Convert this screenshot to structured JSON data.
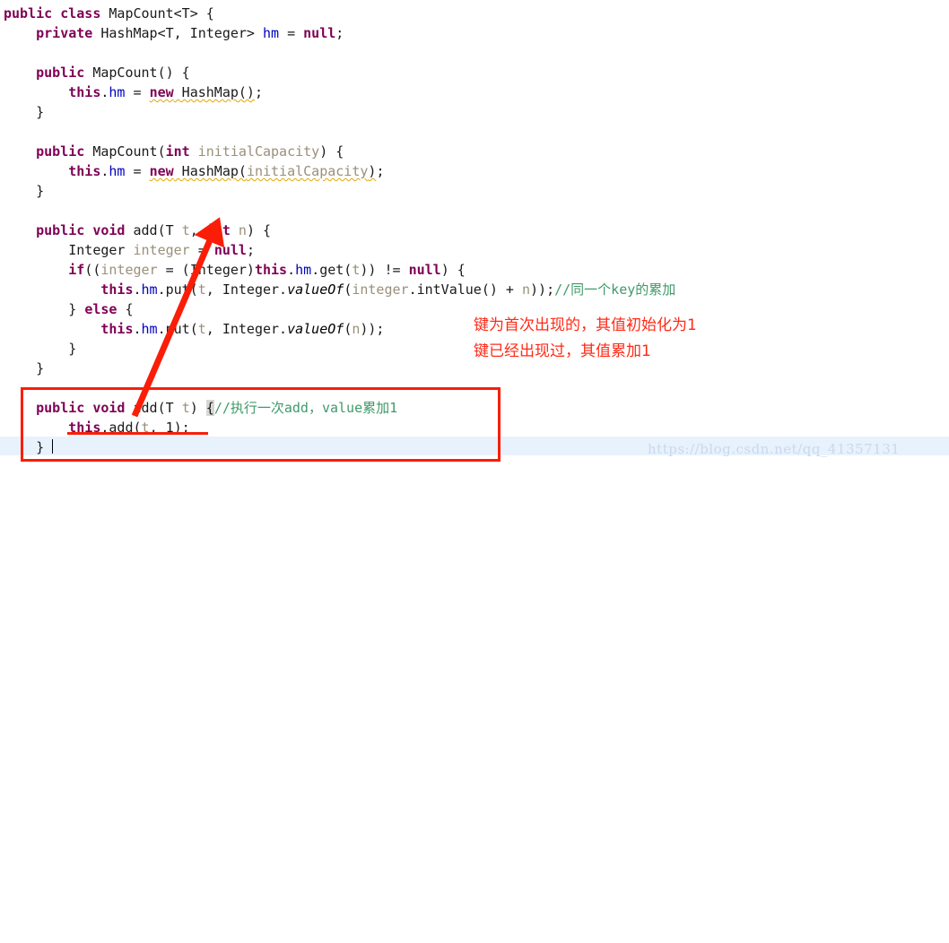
{
  "watermark": "https://blog.csdn.net/qq_41357131",
  "colors": {
    "keyword": "#7f0055",
    "field": "#0000c0",
    "parameter": "#9a8f7a",
    "comment": "#3f9a6a",
    "annotation_red": "#ff2a17",
    "box_red": "#fa1e09",
    "current_line": "#e8f2fc",
    "background": "#ffffff",
    "watermark": "#c9d8ef"
  },
  "code": {
    "language": "java",
    "lines": [
      {
        "n": 1,
        "text": "public class MapCount<T> {"
      },
      {
        "n": 2,
        "text": "    private HashMap<T, Integer> hm = null;"
      },
      {
        "n": 3,
        "text": ""
      },
      {
        "n": 4,
        "text": "    public MapCount() {"
      },
      {
        "n": 5,
        "text": "        this.hm = new HashMap();"
      },
      {
        "n": 6,
        "text": "    }"
      },
      {
        "n": 7,
        "text": ""
      },
      {
        "n": 8,
        "text": "    public MapCount(int initialCapacity) {"
      },
      {
        "n": 9,
        "text": "        this.hm = new HashMap(initialCapacity);"
      },
      {
        "n": 10,
        "text": "    }"
      },
      {
        "n": 11,
        "text": ""
      },
      {
        "n": 12,
        "text": "    public void add(T t, int n) {"
      },
      {
        "n": 13,
        "text": "        Integer integer = null;"
      },
      {
        "n": 14,
        "text": "        if((integer = (Integer)this.hm.get(t)) != null) {"
      },
      {
        "n": 15,
        "text": "            this.hm.put(t, Integer.valueOf(integer.intValue() + n));//同一个key的累加"
      },
      {
        "n": 16,
        "text": "        } else {"
      },
      {
        "n": 17,
        "text": "            this.hm.put(t, Integer.valueOf(n));"
      },
      {
        "n": 18,
        "text": "        }"
      },
      {
        "n": 19,
        "text": "    }"
      },
      {
        "n": 20,
        "text": ""
      },
      {
        "n": 21,
        "text": "    public void add(T t) {//执行一次add，value累加1"
      },
      {
        "n": 22,
        "text": "        this.add(t, 1);"
      },
      {
        "n": 23,
        "text": "    }"
      }
    ]
  },
  "annotations": {
    "red_notes": [
      "键为首次出现的，其值初始化为1",
      "键已经出现过，其值累加1"
    ],
    "inline_comments": [
      "//同一个key的累加",
      "//执行一次add，value累加1"
    ],
    "arrow": {
      "name": "red-arrow",
      "from": "public void add(T t)",
      "to": "add(T t, int n)"
    },
    "highlight_box": {
      "name": "red-rectangle",
      "encloses": "public void add(T t) { this.add(t, 1); }"
    },
    "underline": {
      "name": "red-underline",
      "under": "this.add(t, 1);"
    }
  }
}
